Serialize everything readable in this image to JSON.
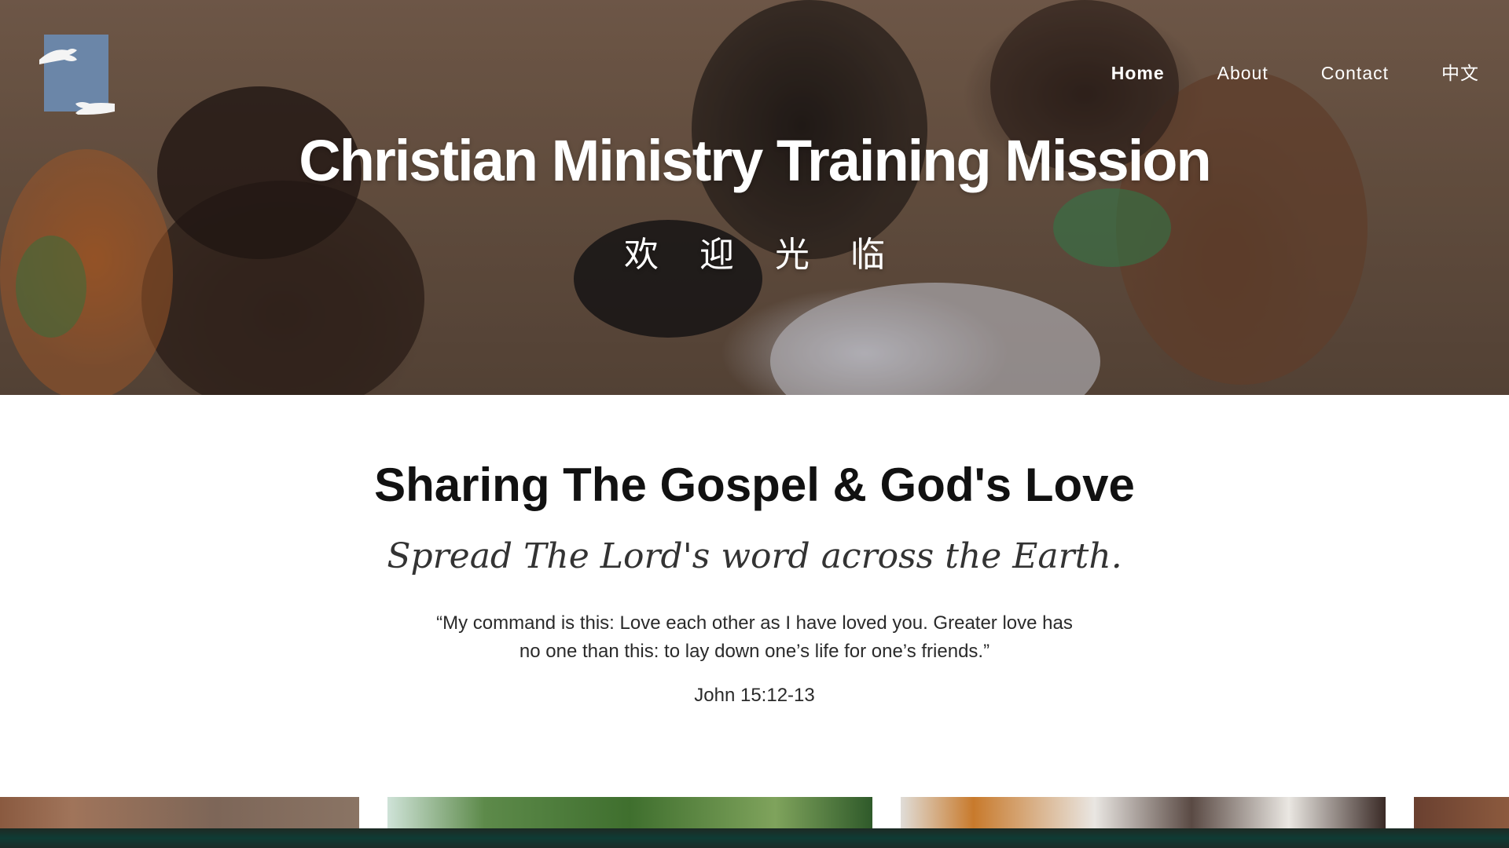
{
  "site": {
    "logo_name": "Christian Ministry Training Mission logo"
  },
  "nav": {
    "items": [
      {
        "label": "Home",
        "active": true
      },
      {
        "label": "About",
        "active": false
      },
      {
        "label": "Contact",
        "active": false
      },
      {
        "label": "中文",
        "active": false
      }
    ]
  },
  "hero": {
    "title": "Christian Ministry Training Mission",
    "subtitle": "欢迎光临"
  },
  "main": {
    "heading": "Sharing The Gospel & God's Love",
    "tagline": "Spread The Lord's word across the Earth.",
    "quote": "“My command is this: Love each other as I have loved you. Greater love has no one than this: to lay down one’s life for one’s friends.”",
    "reference": "John 15:12-13"
  },
  "colors": {
    "logo_bg": "#6b86a8",
    "text_dark": "#111111",
    "nav_text": "#ffffff"
  },
  "gallery": {
    "count_visible": 4
  }
}
